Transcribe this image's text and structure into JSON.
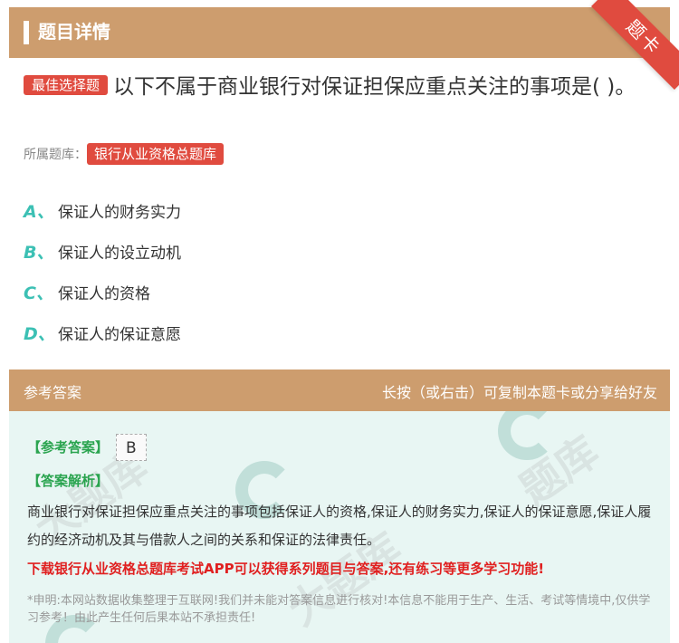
{
  "header": {
    "title": "题目详情",
    "corner_badge": "题卡"
  },
  "question": {
    "type_label": "最佳选择题",
    "text": "以下不属于商业银行对保证担保应重点关注的事项是(    )。",
    "source_label": "所属题库：",
    "source_tag": "银行从业资格总题库"
  },
  "options": [
    {
      "letter": "A、",
      "text": "保证人的财务实力"
    },
    {
      "letter": "B、",
      "text": "保证人的设立动机"
    },
    {
      "letter": "C、",
      "text": "保证人的资格"
    },
    {
      "letter": "D、",
      "text": "保证人的保证意愿"
    }
  ],
  "answer_bar": {
    "left": "参考答案",
    "right": "长按（或右击）可复制本题卡或分享给好友"
  },
  "answer": {
    "ref_label": "【参考答案】",
    "ref_value": "B",
    "analysis_label": "【答案解析】",
    "analysis_text": "商业银行对保证担保应重点关注的事项包括保证人的资格,保证人的财务实力,保证人的保证意愿,保证人履约的经济动机及其与借款人之间的关系和保证的法律责任。",
    "promo": "下载银行从业资格总题库考试APP可以获得系列题目与答案,还有练习等更多学习功能!",
    "note": "*申明:本网站数据收集整理于互联网!我们并未能对答案信息进行核对!本信息不能用于生产、生活、考试等情境中,仅供学习参考！由此产生任何后果本站不承担责任!"
  },
  "colors": {
    "accent": "#cd9d6e",
    "tag_red": "#e04b3f",
    "option_teal": "#3cc0b4",
    "answer_bg": "#e8f6f3",
    "promo_red": "#e02020"
  }
}
